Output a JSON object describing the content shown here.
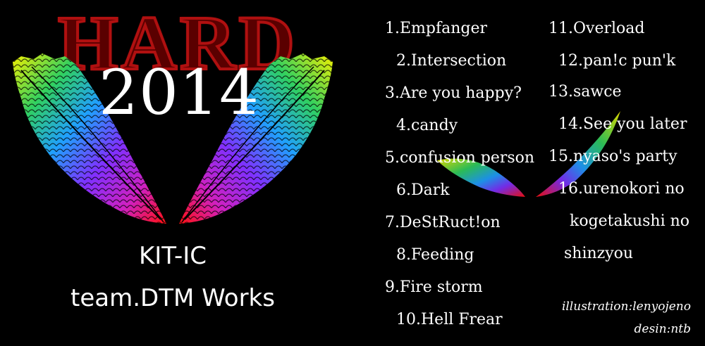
{
  "cover": {
    "title": "HARD",
    "year": "2014",
    "artist_line1": "KIT-IC",
    "artist_line2": "team.DTM Works"
  },
  "tracklist": [
    "1.Empfanger",
    "2.Intersection",
    "3.Are you happy?",
    "4.candy",
    "5.confusion person",
    "6.Dark",
    "7.DeStRuct!on",
    "8.Feeding",
    "9.Fire storm",
    "10.Hell Frear",
    "11.Overload",
    "12.pan!c pun'k",
    "13.sawce",
    "14.See you later",
    "15.nyaso's party",
    "16.urenokori no",
    "kogetakushi no",
    "shinzyou"
  ],
  "credits": {
    "illustration": "illustration:lenyojeno",
    "design": "desin:ntb"
  },
  "colors": {
    "background": "#000000",
    "title_fill": "#5a0000",
    "title_stroke": "#b01010",
    "text": "#ffffff",
    "wing_gradient": [
      "#f5f000",
      "#30d060",
      "#20a0ff",
      "#8030ff",
      "#d020c0",
      "#ff1010"
    ]
  }
}
